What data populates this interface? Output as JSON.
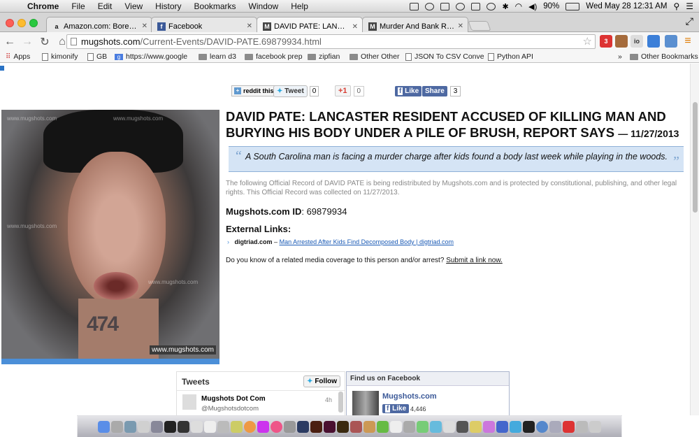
{
  "menubar": {
    "app": "Chrome",
    "items": [
      "File",
      "Edit",
      "View",
      "History",
      "Bookmarks",
      "Window",
      "Help"
    ],
    "battery": "90%",
    "clock": "Wed May 28  12:31 AM"
  },
  "tabs": [
    {
      "favicon": "a",
      "title": "Amazon.com: Bored to De"
    },
    {
      "favicon": "f",
      "title": "Facebook"
    },
    {
      "favicon": "M",
      "title": "DAVID PATE: LANCASTER R"
    },
    {
      "favicon": "M",
      "title": "Murder And Bank Robbery"
    }
  ],
  "omnibox": {
    "host": "mugshots.com",
    "path": "/Current-Events/DAVID-PATE.69879934.html"
  },
  "extensions": [
    {
      "label": "3"
    },
    {
      "label": "io"
    }
  ],
  "bookmarks": [
    {
      "label": "Apps",
      "icon": "apps"
    },
    {
      "label": "kimonify",
      "icon": "page"
    },
    {
      "label": "GB",
      "icon": "page"
    },
    {
      "label": "https://www.google",
      "icon": "google"
    },
    {
      "label": "learn d3",
      "icon": "folder"
    },
    {
      "label": "facebook prep",
      "icon": "folder"
    },
    {
      "label": "zipfian",
      "icon": "folder"
    },
    {
      "label": "Other Other",
      "icon": "folder"
    },
    {
      "label": "JSON To CSV Conve",
      "icon": "page"
    },
    {
      "label": "Python API",
      "icon": "page"
    },
    {
      "label": "Other Bookmarks",
      "icon": "folder"
    }
  ],
  "share": {
    "reddit": "reddit this!",
    "tweet": "Tweet",
    "tweet_count": "0",
    "gplus": "+1",
    "gplus_count": "0",
    "like": "Like",
    "fbshare": "Share",
    "share_count": "3"
  },
  "photo": {
    "watermark": "www.mugshots.com",
    "badge": "www.mugshots.com",
    "tattoo": "474"
  },
  "article": {
    "headline": "DAVID PATE: LANCASTER RESIDENT ACCUSED OF KILLING MAN AND BURYING HIS BODY UNDER A PILE OF BRUSH, REPORT SAYS",
    "date": "— 11/27/2013",
    "quote": "A South Carolina man is facing a murder charge after kids found a body last week while playing in the woods.",
    "record": "The following Official Record of DAVID PATE is being redistributed by Mugshots.com and is protected by constitutional, publishing, and other legal rights. This Official Record was collected on 11/27/2013.",
    "id_label": "Mugshots.com ID",
    "id_value": "69879934",
    "ext_label": "External Links:",
    "ext_source": "digtriad.com",
    "ext_sep": "–",
    "ext_link": "Man Arrested After Kids Find Decomposed Body | digtriad.com",
    "related_q": "Do you know of a related media coverage to this person and/or arrest?",
    "related_link": "Submit a link now."
  },
  "tweets": {
    "title": "Tweets",
    "follow": "Follow",
    "name": "Mugshots Dot Com",
    "handle": "@Mugshotsdotcom",
    "time": "4h"
  },
  "facebook": {
    "title": "Find us on Facebook",
    "page": "Mugshots.com",
    "like": "Like",
    "count": "4,446"
  }
}
